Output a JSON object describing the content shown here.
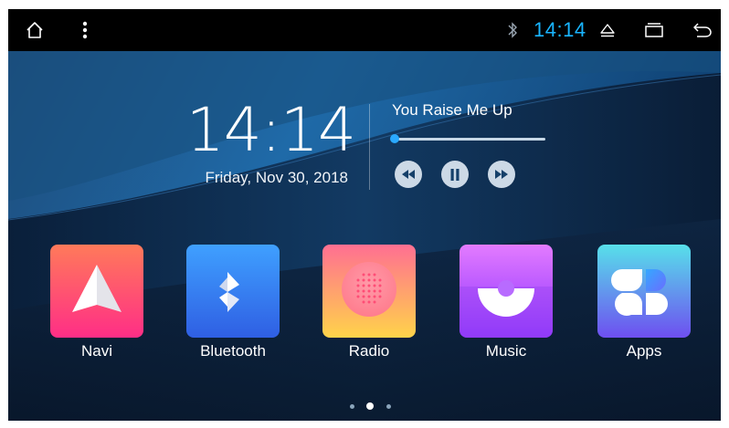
{
  "status_bar": {
    "icons": [
      "home-icon",
      "overflow-menu-icon",
      "bluetooth-icon",
      "eject-icon",
      "recent-apps-icon",
      "back-icon"
    ],
    "time": "14:14",
    "accent_color": "#19b5ff"
  },
  "clock": {
    "time": "14:14",
    "date": "Friday, Nov 30, 2018"
  },
  "media": {
    "song_title": "You Raise Me Up",
    "progress": 0.02,
    "controls": [
      "rewind-icon",
      "pause-icon",
      "fast-forward-icon"
    ]
  },
  "apps": [
    {
      "label": "Navi",
      "icon": "navigation-icon"
    },
    {
      "label": "Bluetooth",
      "icon": "bluetooth-app-icon"
    },
    {
      "label": "Radio",
      "icon": "radio-icon"
    },
    {
      "label": "Music",
      "icon": "music-icon"
    },
    {
      "label": "Apps",
      "icon": "apps-grid-icon"
    }
  ],
  "pager": {
    "pages": 3,
    "current": 2
  }
}
